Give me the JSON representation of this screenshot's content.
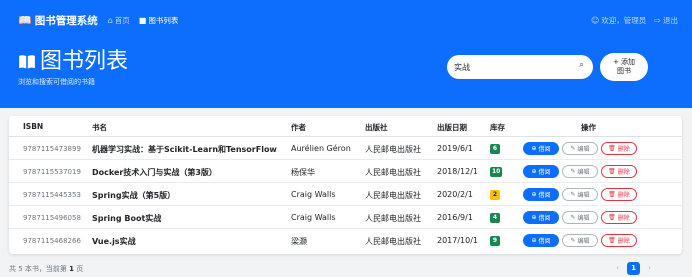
{
  "nav": {
    "brand": "图书管理系统",
    "home": "首页",
    "book_list": "图书列表",
    "welcome": "欢迎，管理员",
    "logout": "退出"
  },
  "hero": {
    "title": "图书列表",
    "subtitle": "浏览和搜索可借阅的书籍"
  },
  "search": {
    "value": "实战",
    "add_label_1": "+ 添加",
    "add_label_2": "图书"
  },
  "table": {
    "columns": [
      "ISBN",
      "书名",
      "作者",
      "出版社",
      "出版日期",
      "库存",
      "操作"
    ],
    "rows": [
      {
        "isbn": "9787115473899",
        "title": "机器学习实战：基于Scikit-Learn和TensorFlow",
        "author": "Aurélien Géron",
        "publisher": "人民邮电出版社",
        "date": "2019/6/1",
        "stock": "6"
      },
      {
        "isbn": "9787115537019",
        "title": "Docker技术入门与实战（第3版）",
        "author": "杨保华",
        "publisher": "人民邮电出版社",
        "date": "2018/12/1",
        "stock": "10"
      },
      {
        "isbn": "9787115445353",
        "title": "Spring实战（第5版）",
        "author": "Craig Walls",
        "publisher": "人民邮电出版社",
        "date": "2020/2/1",
        "stock": "2"
      },
      {
        "isbn": "9787115496058",
        "title": "Spring Boot实战",
        "author": "Craig Walls",
        "publisher": "人民邮电出版社",
        "date": "2016/9/1",
        "stock": "4"
      },
      {
        "isbn": "9787115468266",
        "title": "Vue.js实战",
        "author": "梁灏",
        "publisher": "人民邮电出版社",
        "date": "2017/10/1",
        "stock": "9"
      }
    ],
    "actions": {
      "borrow": "借阅",
      "edit": "编辑",
      "delete": "删除"
    }
  },
  "footer": {
    "prefix": "共 5 本书，当前第",
    "page": "1",
    "suffix": "页",
    "prev": "‹",
    "current": "1",
    "next": "›"
  },
  "colors": {
    "primary": "#0d6efd",
    "stock_high": "#198754",
    "stock_low": "#ffc107",
    "danger": "#dc3545"
  }
}
